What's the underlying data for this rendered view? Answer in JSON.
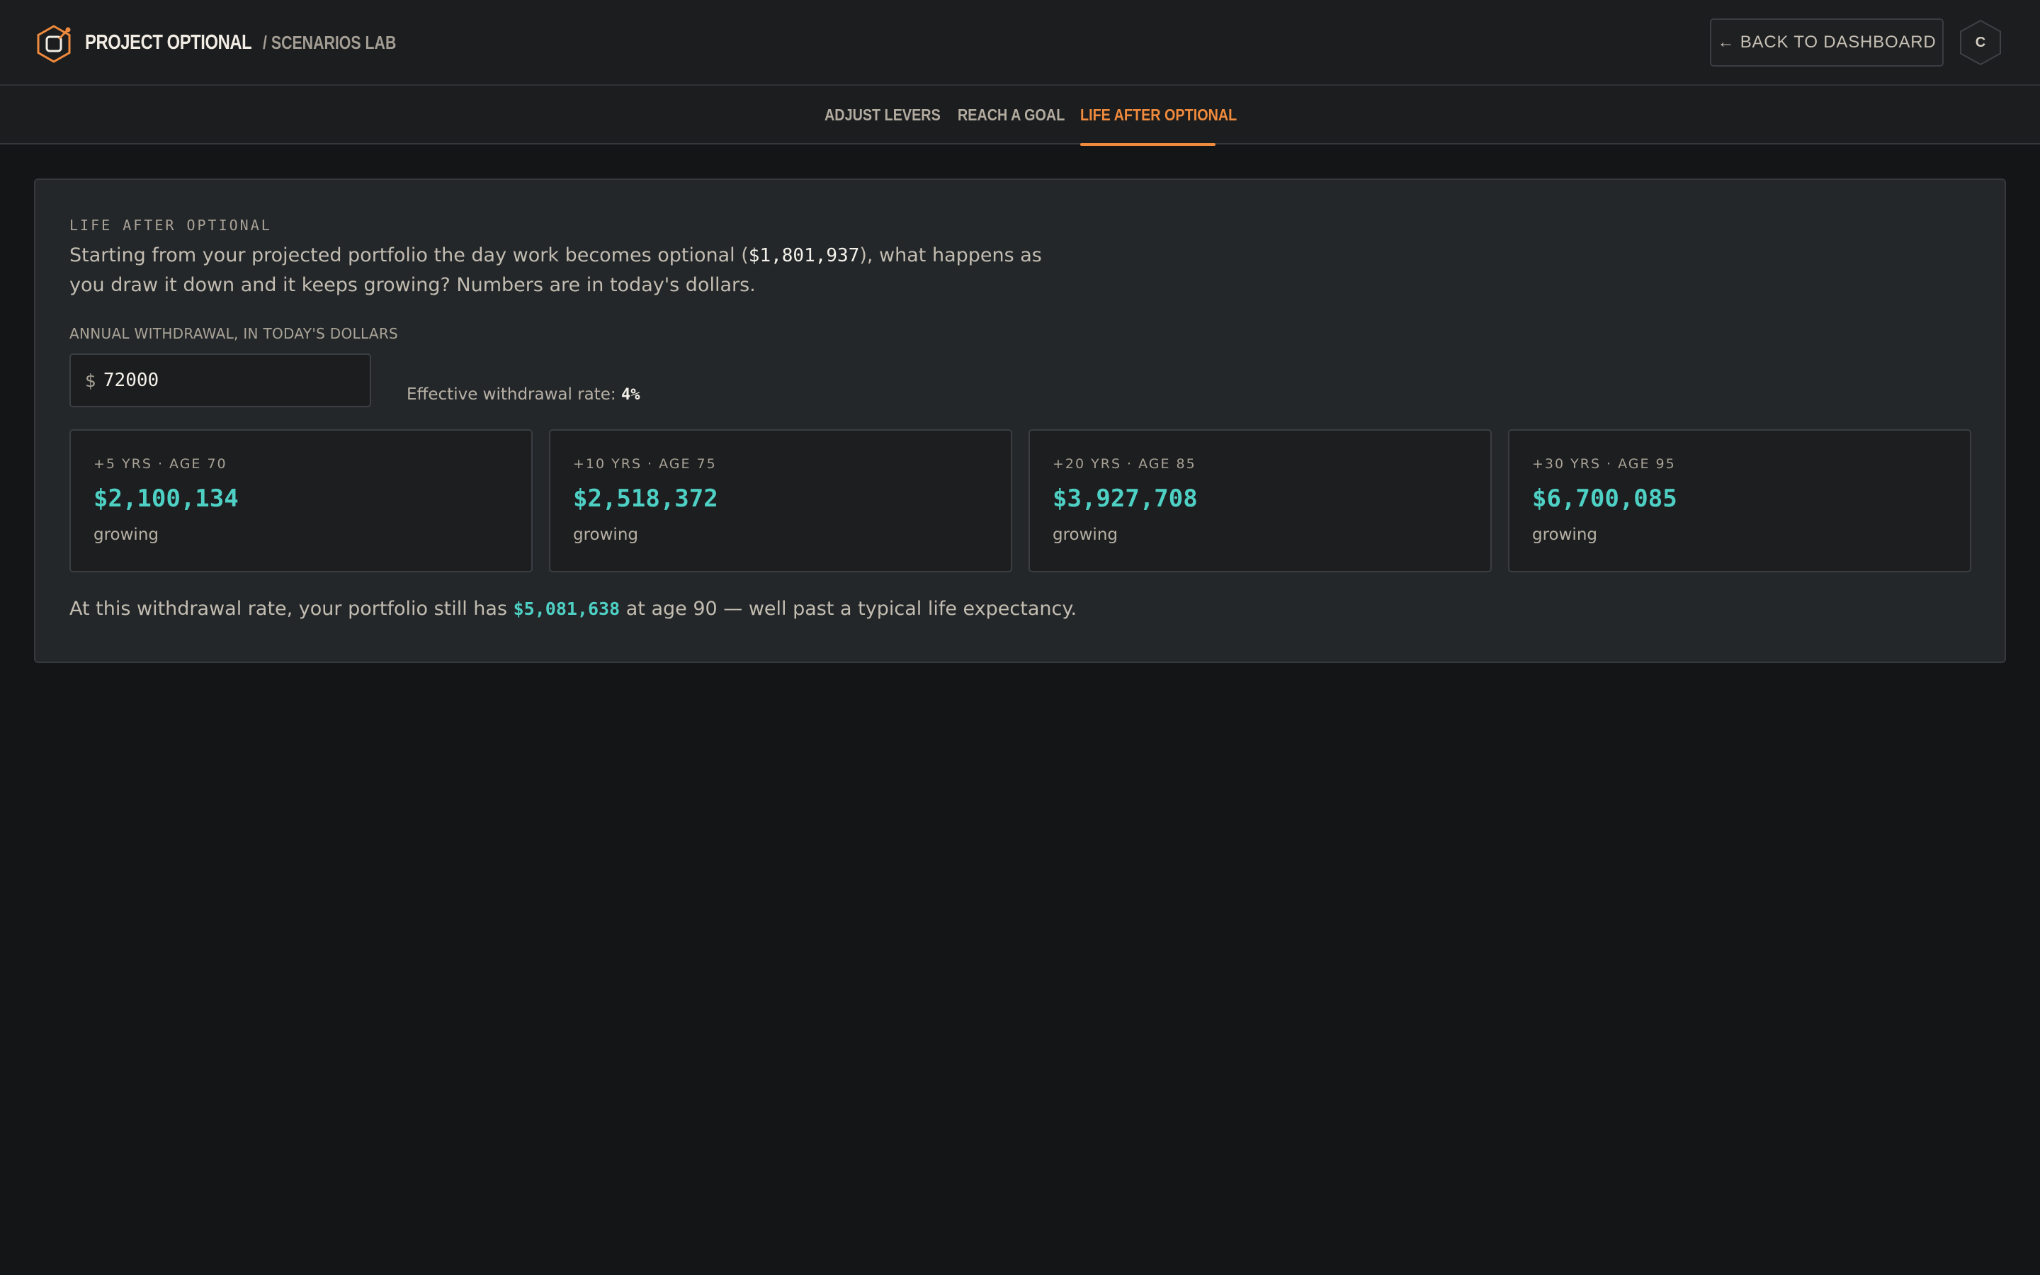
{
  "header": {
    "brand": "PROJECT OPTIONAL",
    "section": "/ SCENARIOS LAB",
    "back_label": "← BACK TO DASHBOARD",
    "avatar_letter": "C",
    "accent": "#f08a3c"
  },
  "tabs": [
    {
      "label": "ADJUST LEVERS",
      "active": false
    },
    {
      "label": "REACH A GOAL",
      "active": false
    },
    {
      "label": "LIFE AFTER OPTIONAL",
      "active": true
    }
  ],
  "panel": {
    "eyebrow": "LIFE AFTER OPTIONAL",
    "intro_before": "Starting from your projected portfolio the day work becomes optional (",
    "intro_amount": "$1,801,937",
    "intro_after": "), what happens as you draw it down and it keeps growing? Numbers are in today's dollars.",
    "withdrawal_label": "ANNUAL WITHDRAWAL, IN TODAY'S DOLLARS",
    "currency_symbol": "$",
    "withdrawal_value": "72000",
    "rate_label": "Effective withdrawal rate:",
    "rate_value": "4%",
    "cards": [
      {
        "label": "+5 YRS · AGE 70",
        "value": "$2,100,134",
        "status": "growing"
      },
      {
        "label": "+10 YRS · AGE 75",
        "value": "$2,518,372",
        "status": "growing"
      },
      {
        "label": "+20 YRS · AGE 85",
        "value": "$3,927,708",
        "status": "growing"
      },
      {
        "label": "+30 YRS · AGE 95",
        "value": "$6,700,085",
        "status": "growing"
      }
    ],
    "summary_before": "At this withdrawal rate, your portfolio still has ",
    "summary_amount": "$5,081,638",
    "summary_after": " at age 90 — well past a typical life expectancy.",
    "value_color": "#4ed1c4"
  }
}
